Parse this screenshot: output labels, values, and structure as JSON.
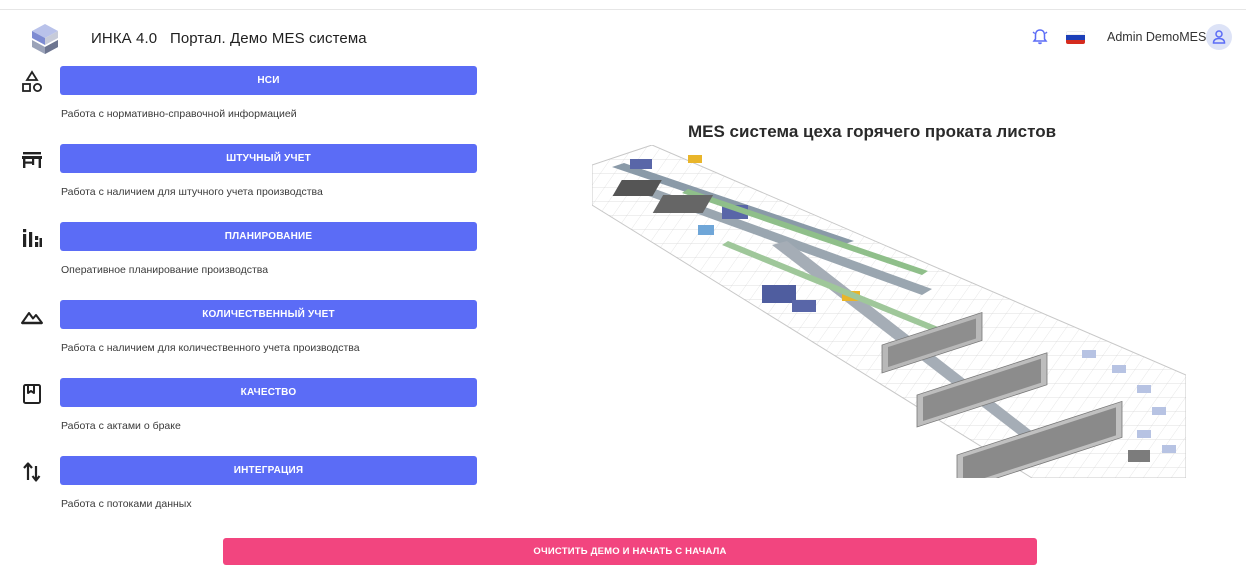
{
  "header": {
    "title": "ИНКА 4.0   Портал. Демо MES система",
    "user_name": "Admin DemoMES",
    "logo_icon": "inka-logo",
    "bell_icon": "alarm-bell-icon",
    "flag_icon": "russia-flag-icon",
    "avatar_icon": "user-icon",
    "accent_color": "#5b6cf6"
  },
  "modules": [
    {
      "icon": "shapes-icon",
      "label": "НСИ",
      "description": "Работа с нормативно-справочной информацией"
    },
    {
      "icon": "store-icon",
      "label": "ШТУЧНЫЙ УЧЕТ",
      "description": "Работа с наличием для штучного учета производства"
    },
    {
      "icon": "bar-chart-icon",
      "label": "ПЛАНИРОВАНИЕ",
      "description": "Оперативное планирование производства"
    },
    {
      "icon": "landscape-icon",
      "label": "КОЛИЧЕСТВЕННЫЙ УЧЕТ",
      "description": "Работа с наличием для количественного учета производства"
    },
    {
      "icon": "bookmark-book-icon",
      "label": "КАЧЕСТВО",
      "description": "Работа с актами о браке"
    },
    {
      "icon": "swap-vert-icon",
      "label": "ИНТЕГРАЦИЯ",
      "description": "Работа с потоками данных"
    }
  ],
  "main": {
    "title": "MES система цеха горячего проката листов"
  },
  "footer": {
    "reset_label": "ОЧИСТИТЬ ДЕМО И НАЧАТЬ С НАЧАЛА",
    "reset_color": "#f2457f"
  }
}
